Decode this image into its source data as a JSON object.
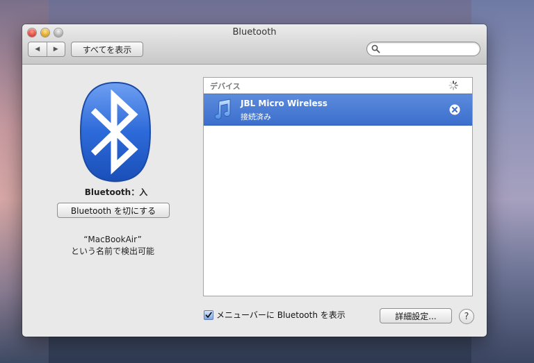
{
  "window": {
    "title": "Bluetooth"
  },
  "toolbar": {
    "back_icon": "◀",
    "forward_icon": "▶",
    "show_all_label": "すべてを表示",
    "search_placeholder": ""
  },
  "bluetooth": {
    "status_label": "Bluetooth：入",
    "toggle_button_label": "Bluetooth を切にする",
    "discoverable_line1": "“MacBookAir”",
    "discoverable_line2": "という名前で検出可能"
  },
  "devices": {
    "header_label": "デバイス",
    "items": [
      {
        "name": "JBL Micro Wireless",
        "status": "接続済み",
        "icon": "music-note-icon",
        "selected": true
      }
    ]
  },
  "footer": {
    "show_in_menubar_label": "メニューバーに Bluetooth を表示",
    "show_in_menubar_checked": true,
    "advanced_button_label": "詳細設定...",
    "help_label": "?"
  },
  "colors": {
    "selection": "#3c6fcd",
    "bluetooth_blue": "#2d6ad9",
    "arrow": "#f0336e"
  }
}
